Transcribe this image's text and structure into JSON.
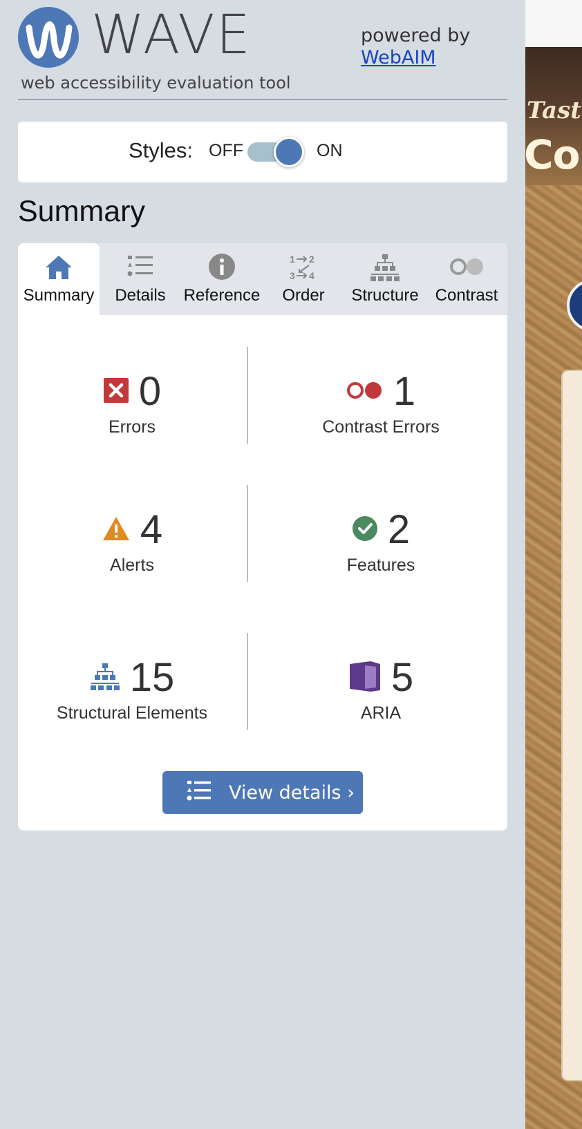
{
  "header": {
    "logo_text": "WAVE",
    "tagline": "web accessibility evaluation tool",
    "powered_by": "powered by",
    "webaim_link": "WebAIM"
  },
  "styles_toggle": {
    "label": "Styles:",
    "off": "OFF",
    "on": "ON",
    "state": "on"
  },
  "summary_heading": "Summary",
  "tabs": [
    {
      "label": "Summary",
      "icon": "home-icon",
      "active": true
    },
    {
      "label": "Details",
      "icon": "list-icon",
      "active": false
    },
    {
      "label": "Reference",
      "icon": "info-icon",
      "active": false
    },
    {
      "label": "Order",
      "icon": "order-icon",
      "active": false
    },
    {
      "label": "Structure",
      "icon": "structure-icon",
      "active": false
    },
    {
      "label": "Contrast",
      "icon": "contrast-icon",
      "active": false
    }
  ],
  "stats": {
    "errors": {
      "count": "0",
      "label": "Errors",
      "color": "#c1393a"
    },
    "contrast_errors": {
      "count": "1",
      "label": "Contrast Errors",
      "color": "#c1393a"
    },
    "alerts": {
      "count": "4",
      "label": "Alerts",
      "color": "#e08a22"
    },
    "features": {
      "count": "2",
      "label": "Features",
      "color": "#4a8a5e"
    },
    "structural": {
      "count": "15",
      "label": "Structural Elements",
      "color": "#4e77b5"
    },
    "aria": {
      "count": "5",
      "label": "ARIA",
      "color": "#5b3a8c"
    }
  },
  "view_details_button": "View details ›",
  "background_page": {
    "tagline_fragment": "Taste",
    "heading_fragment": "Co"
  }
}
